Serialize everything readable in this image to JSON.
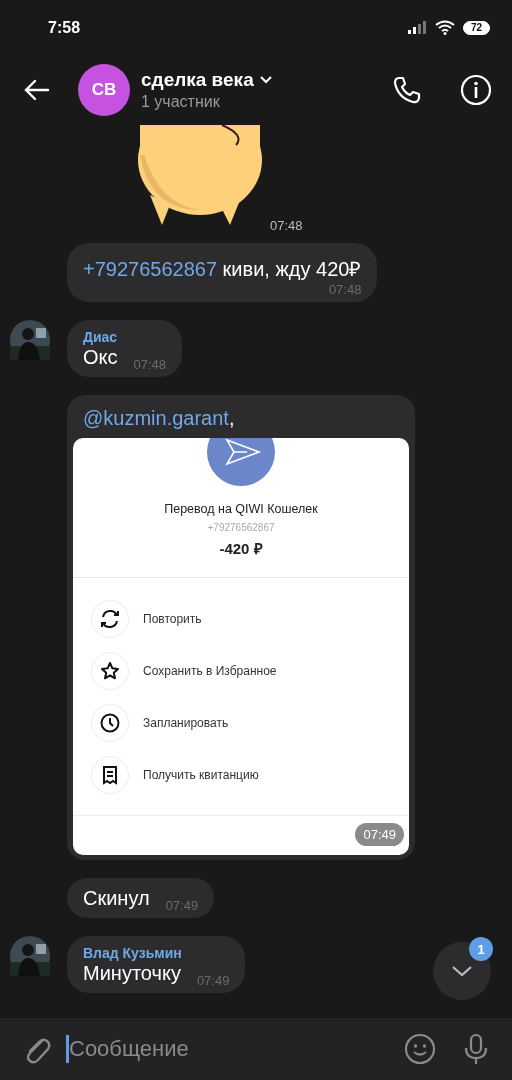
{
  "status_bar": {
    "time": "7:58",
    "battery": "72"
  },
  "header": {
    "avatar_initials": "СВ",
    "title": "сделка века",
    "subtitle": "1 участник"
  },
  "messages": [
    {
      "kind": "sticker",
      "time": "07:48"
    },
    {
      "kind": "phone",
      "link": "+79276562867",
      "text": "киви, жду 420₽",
      "time": "07:48"
    },
    {
      "kind": "text",
      "sender": "Диас",
      "avatar": true,
      "text": "Окс",
      "time": "07:48"
    },
    {
      "kind": "screenshot",
      "mention": "@kuzmin.garant",
      "text": ",",
      "time": "07:49",
      "shot": {
        "title": "Перевод на QIWI Кошелек",
        "phone": "+79276562867",
        "amount": "-420 ₽",
        "actions": [
          {
            "label": "Повторить"
          },
          {
            "label": "Сохранить в Избранное"
          },
          {
            "label": "Запланировать"
          },
          {
            "label": "Получить квитанцию"
          }
        ]
      }
    },
    {
      "kind": "text",
      "text": "Скинул",
      "time": "07:49"
    },
    {
      "kind": "text",
      "sender": "Влад Кузьмин",
      "avatar": true,
      "text": "Минуточку",
      "time": "07:49"
    }
  ],
  "scroll_down": {
    "badge": "1"
  },
  "composer": {
    "placeholder": "Сообщение"
  }
}
